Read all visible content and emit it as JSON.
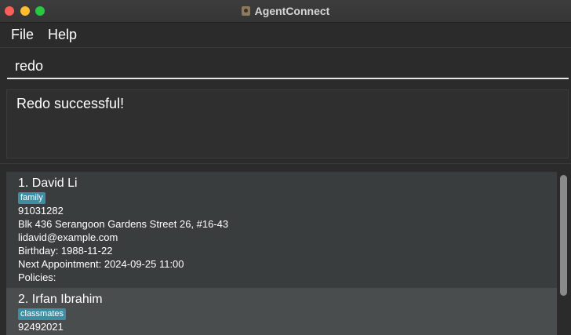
{
  "window": {
    "title": "AgentConnect"
  },
  "menu": {
    "file": "File",
    "help": "Help"
  },
  "command": {
    "value": "redo"
  },
  "result": {
    "message": "Redo successful!"
  },
  "contacts": [
    {
      "index_name": "1. David Li",
      "tag": "family",
      "phone": "91031282",
      "address": "Blk 436 Serangoon Gardens Street 26, #16-43",
      "email": "lidavid@example.com",
      "birthday": "Birthday: 1988-11-22",
      "appointment": "Next Appointment: 2024-09-25 11:00",
      "policies": "Policies:"
    },
    {
      "index_name": "2. Irfan Ibrahim",
      "tag": "classmates",
      "phone": "92492021"
    }
  ],
  "colors": {
    "tag_bg": "#3d8ea0",
    "card_selected_bg": "#4a4d4e"
  }
}
